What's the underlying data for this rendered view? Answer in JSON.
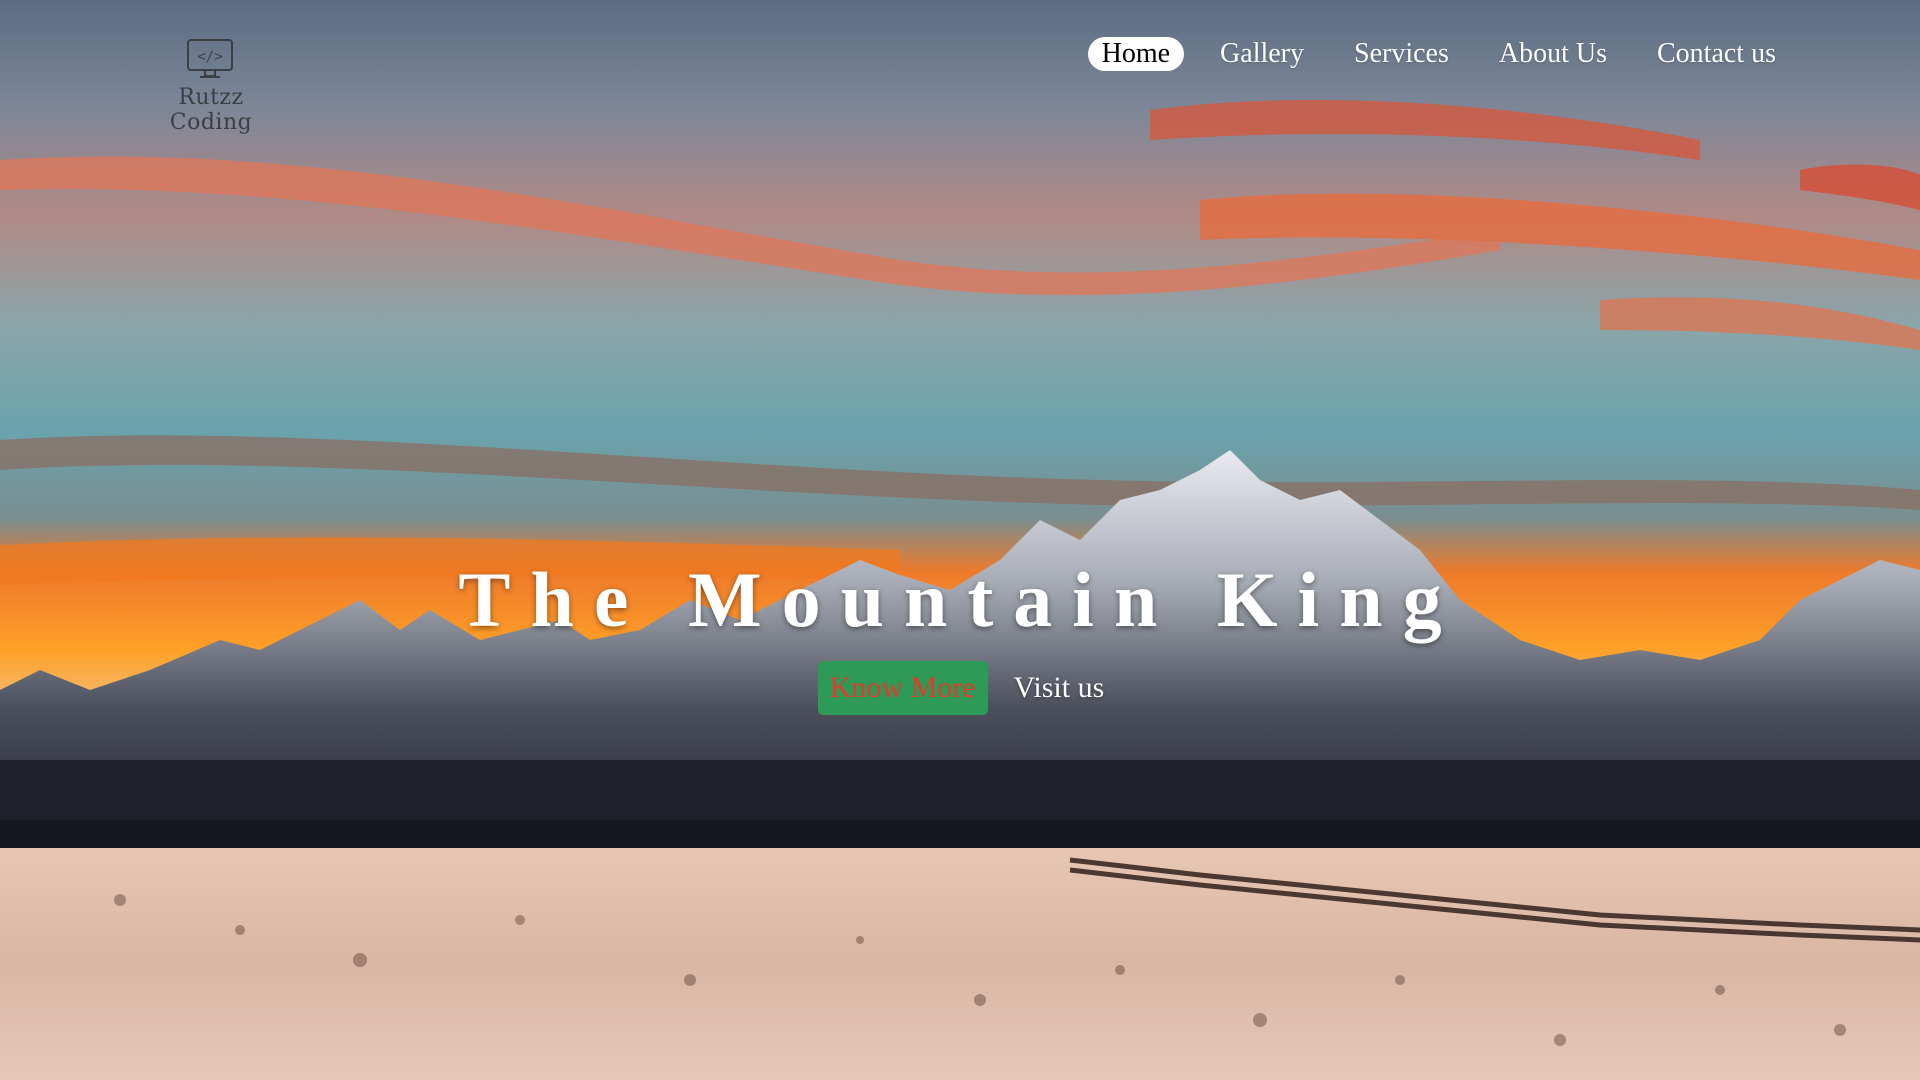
{
  "brand": {
    "name": "Rutzz Coding",
    "logo_icon": "code-monitor-icon"
  },
  "nav": {
    "items": [
      {
        "label": "Home",
        "active": true
      },
      {
        "label": "Gallery",
        "active": false
      },
      {
        "label": "Services",
        "active": false
      },
      {
        "label": "About Us",
        "active": false
      },
      {
        "label": "Contact us",
        "active": false
      }
    ]
  },
  "hero": {
    "title": "The Mountain King",
    "primary_button": "Know More",
    "secondary_button": "Visit us",
    "colors": {
      "primary_button_bg": "#2f9a58",
      "primary_button_text": "#e53b2a"
    }
  }
}
